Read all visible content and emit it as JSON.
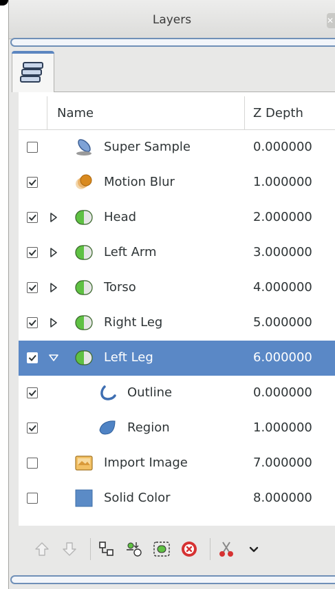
{
  "panel": {
    "title": "Layers"
  },
  "tabs": [
    {
      "icon": "layers-stack-icon",
      "active": true
    }
  ],
  "columns": {
    "name": "Name",
    "zdepth": "Z Depth"
  },
  "layers": [
    {
      "name": "Super Sample",
      "zdepth": "0.000000",
      "checked": false,
      "expander": "none",
      "icon": "super-sample-icon",
      "level": 0,
      "selected": false
    },
    {
      "name": "Motion Blur",
      "zdepth": "1.000000",
      "checked": true,
      "expander": "none",
      "icon": "motion-blur-icon",
      "level": 0,
      "selected": false
    },
    {
      "name": "Head",
      "zdepth": "2.000000",
      "checked": true,
      "expander": "collapsed",
      "icon": "group-layer-icon",
      "level": 0,
      "selected": false
    },
    {
      "name": "Left Arm",
      "zdepth": "3.000000",
      "checked": true,
      "expander": "collapsed",
      "icon": "group-layer-icon",
      "level": 0,
      "selected": false
    },
    {
      "name": "Torso",
      "zdepth": "4.000000",
      "checked": true,
      "expander": "collapsed",
      "icon": "group-layer-icon",
      "level": 0,
      "selected": false
    },
    {
      "name": "Right Leg",
      "zdepth": "5.000000",
      "checked": true,
      "expander": "collapsed",
      "icon": "group-layer-icon",
      "level": 0,
      "selected": false
    },
    {
      "name": "Left Leg",
      "zdepth": "6.000000",
      "checked": true,
      "expander": "expanded",
      "icon": "group-layer-icon",
      "level": 0,
      "selected": true
    },
    {
      "name": "Outline",
      "zdepth": "0.000000",
      "checked": true,
      "expander": "none",
      "icon": "outline-layer-icon",
      "level": 1,
      "selected": false
    },
    {
      "name": "Region",
      "zdepth": "1.000000",
      "checked": true,
      "expander": "none",
      "icon": "region-layer-icon",
      "level": 1,
      "selected": false
    },
    {
      "name": "Import Image",
      "zdepth": "7.000000",
      "checked": false,
      "expander": "none",
      "icon": "import-image-icon",
      "level": 0,
      "selected": false
    },
    {
      "name": "Solid Color",
      "zdepth": "8.000000",
      "checked": false,
      "expander": "none",
      "icon": "solid-color-icon",
      "level": 0,
      "selected": false
    }
  ],
  "toolbar": [
    {
      "icon": "raise-layer-icon",
      "enabled": false
    },
    {
      "icon": "lower-layer-icon",
      "enabled": false
    },
    {
      "icon": "separator"
    },
    {
      "icon": "duplicate-layer-icon",
      "enabled": true
    },
    {
      "icon": "encapsulate-layer-icon",
      "enabled": true
    },
    {
      "icon": "select-layer-icon",
      "enabled": true
    },
    {
      "icon": "delete-layer-icon",
      "enabled": true
    },
    {
      "icon": "separator"
    },
    {
      "icon": "cut-layer-icon",
      "enabled": true
    },
    {
      "icon": "more-chevron-down-icon",
      "enabled": true
    }
  ],
  "colors": {
    "selection": "#5a88c6",
    "accent": "#5c86c0",
    "group_icon_green": "#5fc143",
    "solid_color": "#5b8bc6",
    "delete_red": "#d63232"
  }
}
